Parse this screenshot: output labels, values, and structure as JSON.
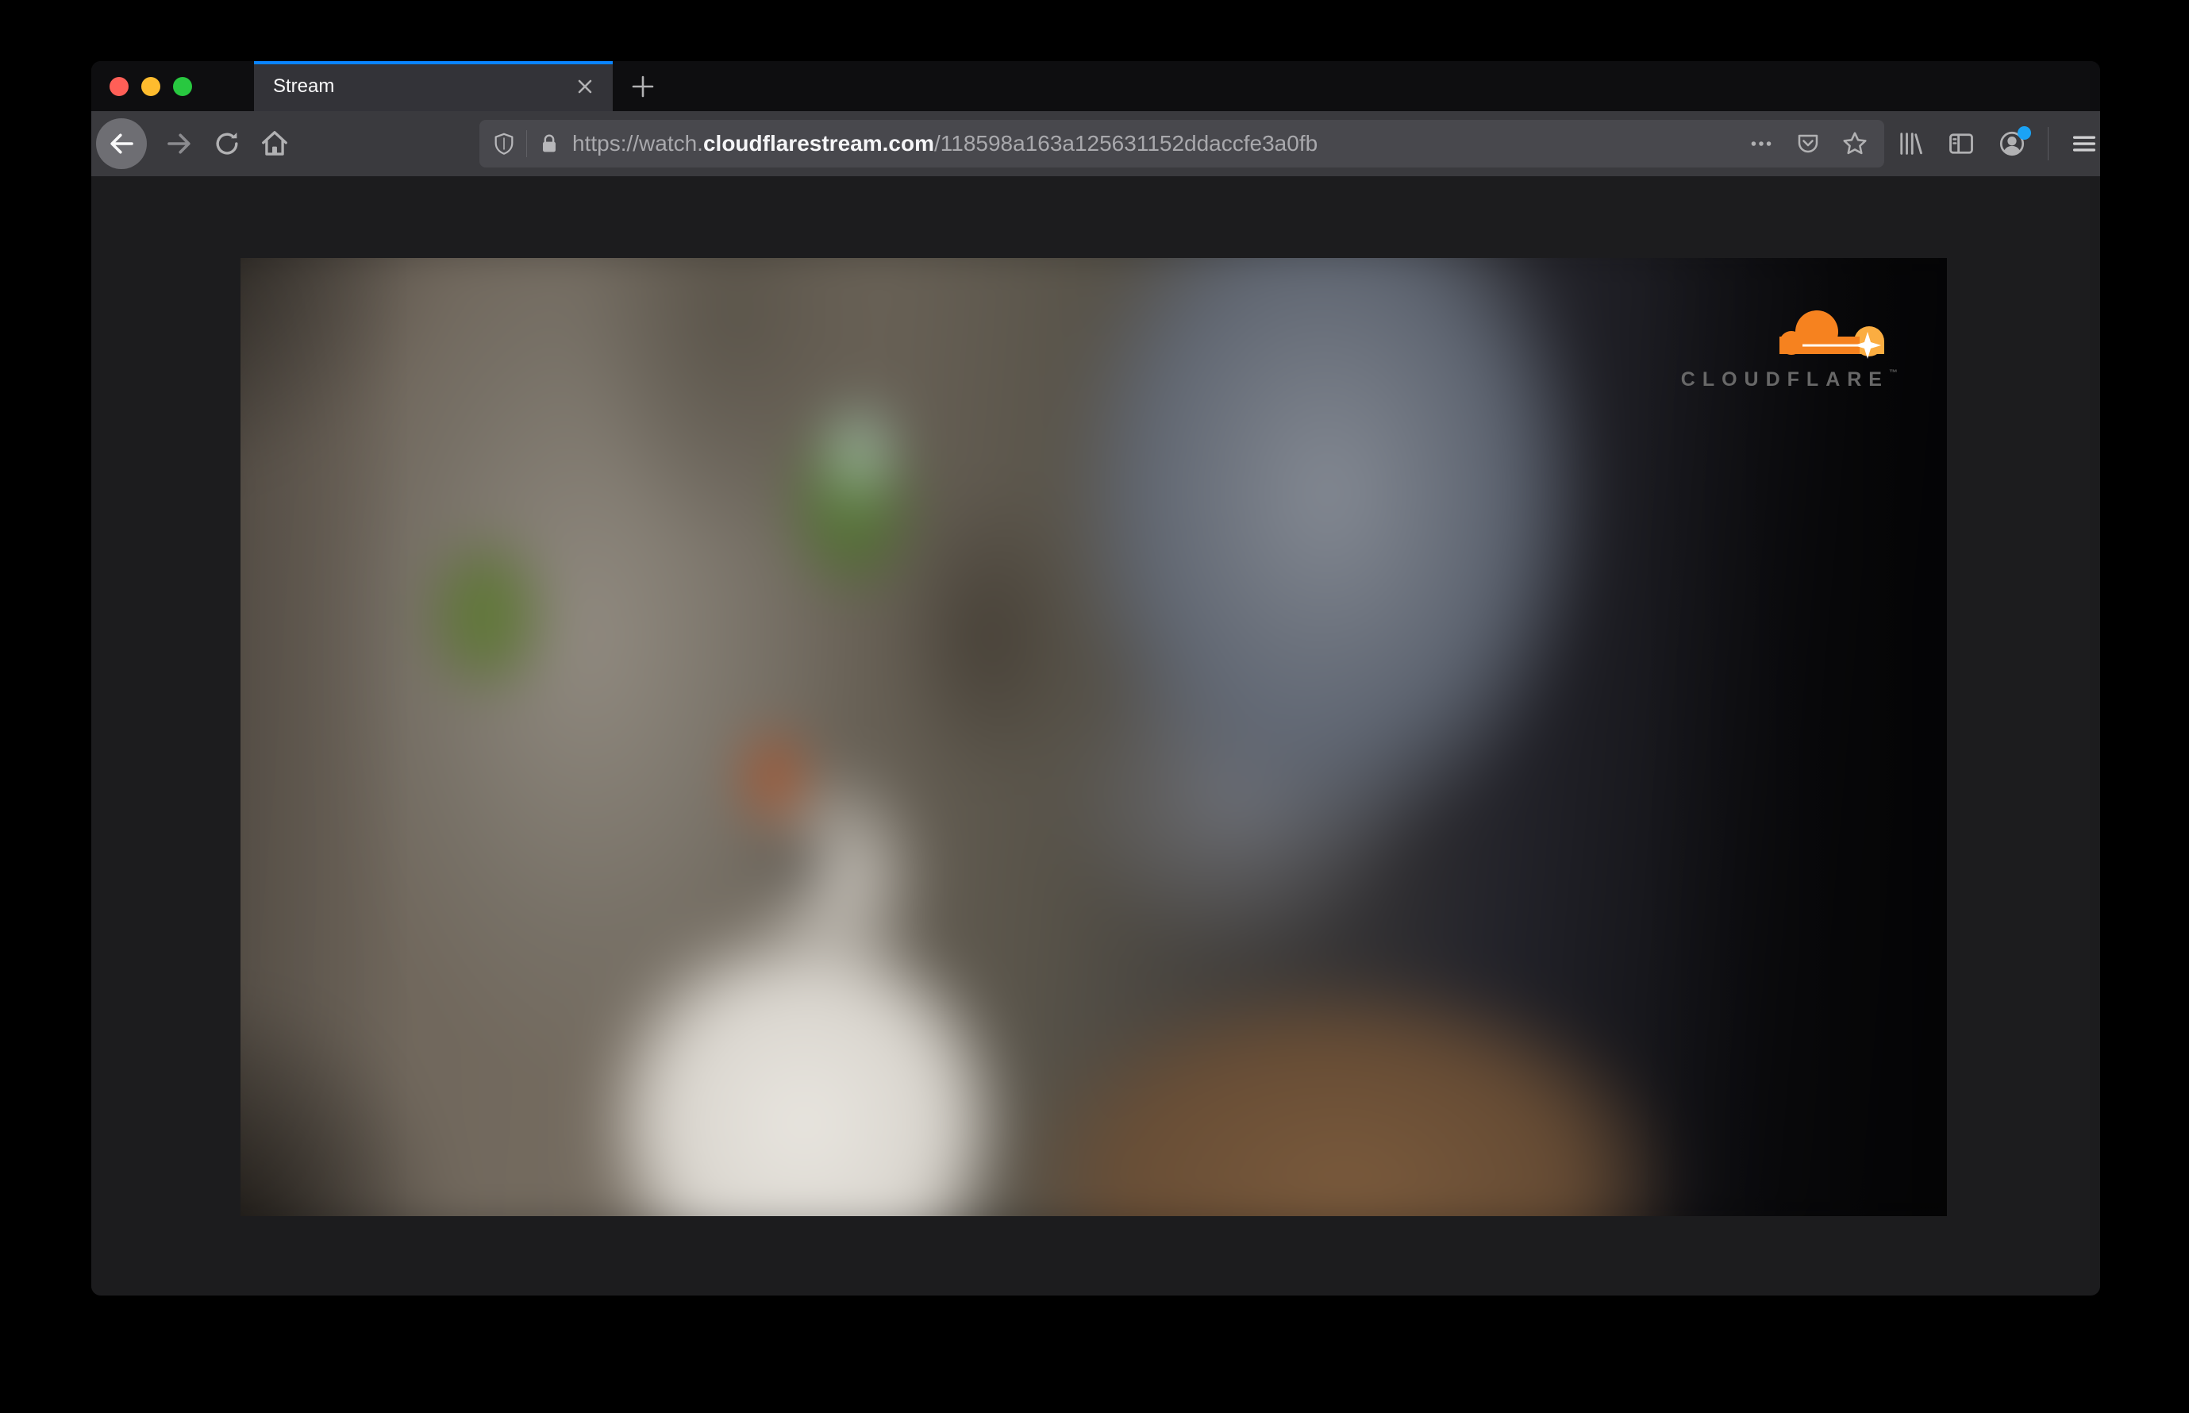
{
  "meta": {
    "window_title": "Stream"
  },
  "colors": {
    "accent_blue": "#0a84ff",
    "traffic_red": "#ff5f57",
    "traffic_yellow": "#febc2e",
    "traffic_green": "#28c840",
    "toolbar_bg": "#3a3a3e",
    "tabbar_bg": "#0e0e10",
    "urlbar_bg": "#48484d",
    "page_bg": "#1c1c1e",
    "notification_dot": "#1ba3f5",
    "cloudflare_orange": "#f6821f",
    "cloudflare_orange_light": "#fbad41"
  },
  "titlebar": {
    "tab": {
      "title": "Stream"
    },
    "new_tab_glyph": "+",
    "close_tab_glyph": "✕"
  },
  "navbar": {
    "url": {
      "prefix": "https://watch.",
      "domain": "cloudflarestream.com",
      "path": "/118598a163a125631152ddaccfe3a0fb"
    }
  },
  "icons": {
    "back": "arrow-left",
    "forward": "arrow-right",
    "reload": "circular-arrow",
    "home": "house",
    "tracking-protection": "shield",
    "connection-security": "padlock",
    "page-actions": "ellipsis",
    "pocket": "pocket-chevron",
    "bookmark": "star-outline",
    "library": "tilted-books",
    "sidebar": "split-panel",
    "account": "person-in-circle",
    "menu": "hamburger",
    "cloudflare-logo": "orange-cloud-with-sparkle"
  },
  "video": {
    "description": "blurry close-up of a grey tabby cat with green eyes",
    "logo_text": "CLOUDFLARE",
    "logo_tm": "™"
  }
}
